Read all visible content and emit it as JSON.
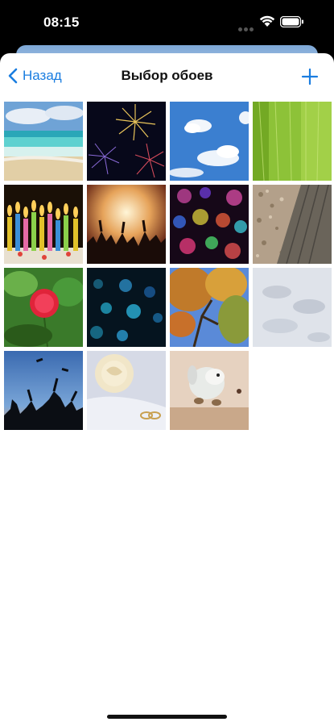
{
  "status": {
    "time": "08:15"
  },
  "nav": {
    "back_label": "Назад",
    "title": "Выбор обоев"
  },
  "wallpapers": [
    {
      "icon": "beach-photo"
    },
    {
      "icon": "fireworks-photo"
    },
    {
      "icon": "blue-sky-clouds-photo"
    },
    {
      "icon": "green-leaf-photo"
    },
    {
      "icon": "birthday-candles-photo"
    },
    {
      "icon": "concert-crowd-photo"
    },
    {
      "icon": "colorful-bokeh-photo"
    },
    {
      "icon": "pebbles-wood-photo"
    },
    {
      "icon": "red-flower-photo"
    },
    {
      "icon": "blue-bokeh-photo"
    },
    {
      "icon": "autumn-tree-photo"
    },
    {
      "icon": "snow-footprints-photo"
    },
    {
      "icon": "graduation-silhouettes-photo"
    },
    {
      "icon": "rose-rings-photo"
    },
    {
      "icon": "plush-toy-photo"
    }
  ],
  "colors": {
    "accent": "#1a7de0"
  }
}
